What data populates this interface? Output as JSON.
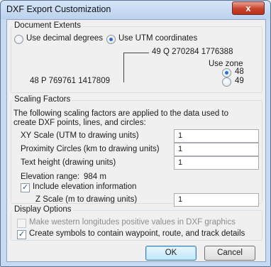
{
  "window": {
    "title": "DXF Export Customization",
    "close_glyph": "x"
  },
  "document_extents": {
    "group_title": "Document Extents",
    "radio_decimal_label": "Use decimal degrees",
    "radio_utm_label": "Use UTM coordinates",
    "selected": "utm",
    "coord_top_right": "49 Q 270284 1776388",
    "coord_bottom_left": "48 P 769761 1417809",
    "use_zone_label": "Use zone",
    "zone_48_label": "48",
    "zone_49_label": "49",
    "selected_zone": "48"
  },
  "scaling": {
    "group_title": "Scaling Factors",
    "description_line1": "The following scaling factors are applied to the data used to",
    "description_line2": "create DXF points, lines, and circles:",
    "xy_label": "XY Scale (UTM to drawing units)",
    "xy_value": "1",
    "proximity_label": "Proximity Circles (km to drawing units)",
    "proximity_value": "1",
    "text_height_label": "Text height (drawing units)",
    "text_height_value": "1",
    "elevation_range_label": "Elevation range:",
    "elevation_range_value": "984 m",
    "include_elevation_label": "Include elevation information",
    "include_elevation_checked": true,
    "z_scale_label": "Z Scale (m to drawing units)",
    "z_scale_value": "1"
  },
  "display": {
    "group_title": "Display Options",
    "western_label": "Make western longitudes positive values in DXF graphics",
    "western_enabled": false,
    "symbols_label": "Create symbols to contain waypoint, route, and track details",
    "symbols_checked": true,
    "check_glyph": "✓"
  },
  "buttons": {
    "ok_label": "OK",
    "cancel_label": "Cancel"
  }
}
